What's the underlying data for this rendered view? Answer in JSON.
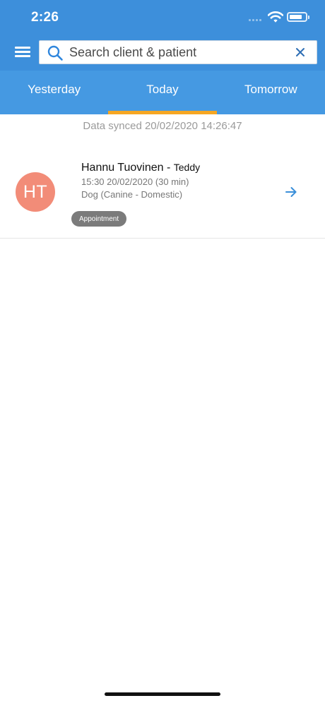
{
  "status_bar": {
    "time": "2:26",
    "icons": [
      "signal-icon",
      "wifi-icon",
      "battery-icon"
    ]
  },
  "header": {
    "menu_icon": "menu-icon",
    "search": {
      "placeholder": "Search client & patient",
      "value": "",
      "icon": "search-icon",
      "clear_icon": "clear-icon"
    }
  },
  "tabs": [
    {
      "label": "Yesterday",
      "active": false
    },
    {
      "label": "Today",
      "active": true
    },
    {
      "label": "Tomorrow",
      "active": false
    }
  ],
  "sync_status": "Data synced 20/02/2020 14:26:47",
  "appointments": [
    {
      "initials": "HT",
      "client_name": "Hannu Tuovinen - ",
      "patient_name": "Teddy",
      "time": "15:30 20/02/2020 (30 min)",
      "species": "Dog (Canine - Domestic)",
      "badge": "Appointment",
      "action_icon": "arrow-right-icon"
    }
  ],
  "colors": {
    "header_blue": "#3d8fdb",
    "tab_blue": "#4599e2",
    "active_tab_indicator": "#f5a623",
    "avatar": "#f28c78",
    "badge": "#7b7b7b"
  }
}
